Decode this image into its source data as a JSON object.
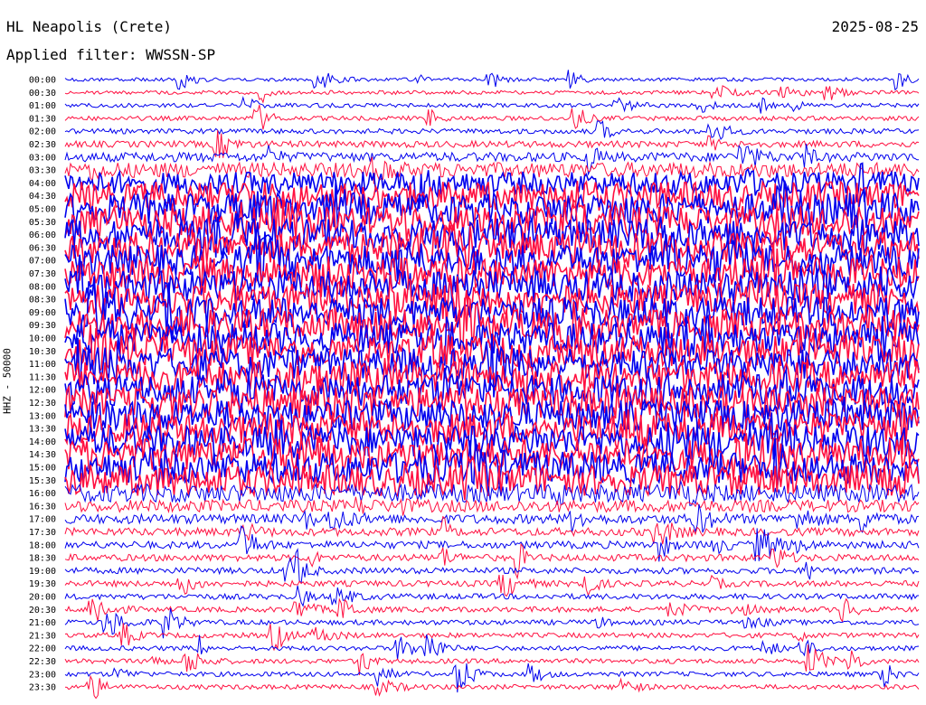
{
  "header": {
    "station": "HL Neapolis (Crete)",
    "date": "2025-08-25",
    "filter": "Applied filter: WWSSN-SP"
  },
  "y_axis_label": "HHZ - 50000",
  "colors": {
    "trace_a": "#0000ee",
    "trace_b": "#ff1040",
    "background": "#ffffff"
  },
  "chart_data": {
    "type": "line",
    "title": "HL Neapolis (Crete)",
    "subtitle": "Applied filter: WWSSN-SP",
    "ylabel": "HHZ - 50000",
    "row_labels": [
      "00:00",
      "00:30",
      "01:00",
      "01:30",
      "02:00",
      "02:30",
      "03:00",
      "03:30",
      "04:00",
      "04:30",
      "05:00",
      "05:30",
      "06:00",
      "06:30",
      "07:00",
      "07:30",
      "08:00",
      "08:30",
      "09:00",
      "09:30",
      "10:00",
      "10:30",
      "11:00",
      "11:30",
      "12:00",
      "12:30",
      "13:00",
      "13:30",
      "14:00",
      "14:30",
      "15:00",
      "15:30",
      "16:00",
      "16:30",
      "17:00",
      "17:30",
      "18:00",
      "18:30",
      "19:00",
      "19:30",
      "20:00",
      "20:30",
      "21:00",
      "21:30",
      "22:00",
      "22:30",
      "23:00",
      "23:30"
    ],
    "row_colors": [
      "#0000ee",
      "#ff1040"
    ],
    "noise_level_per_row": [
      0.05,
      0.06,
      0.07,
      0.08,
      0.1,
      0.15,
      0.25,
      0.45,
      0.7,
      0.9,
      1,
      1,
      1,
      1,
      1,
      1,
      1,
      1,
      1,
      1,
      1,
      1,
      1,
      1,
      1,
      1,
      1,
      1,
      1,
      1,
      1,
      1,
      0.55,
      0.35,
      0.25,
      0.2,
      0.18,
      0.16,
      0.14,
      0.13,
      0.12,
      0.11,
      0.1,
      0.1,
      0.09,
      0.09,
      0.09,
      0.09
    ]
  }
}
